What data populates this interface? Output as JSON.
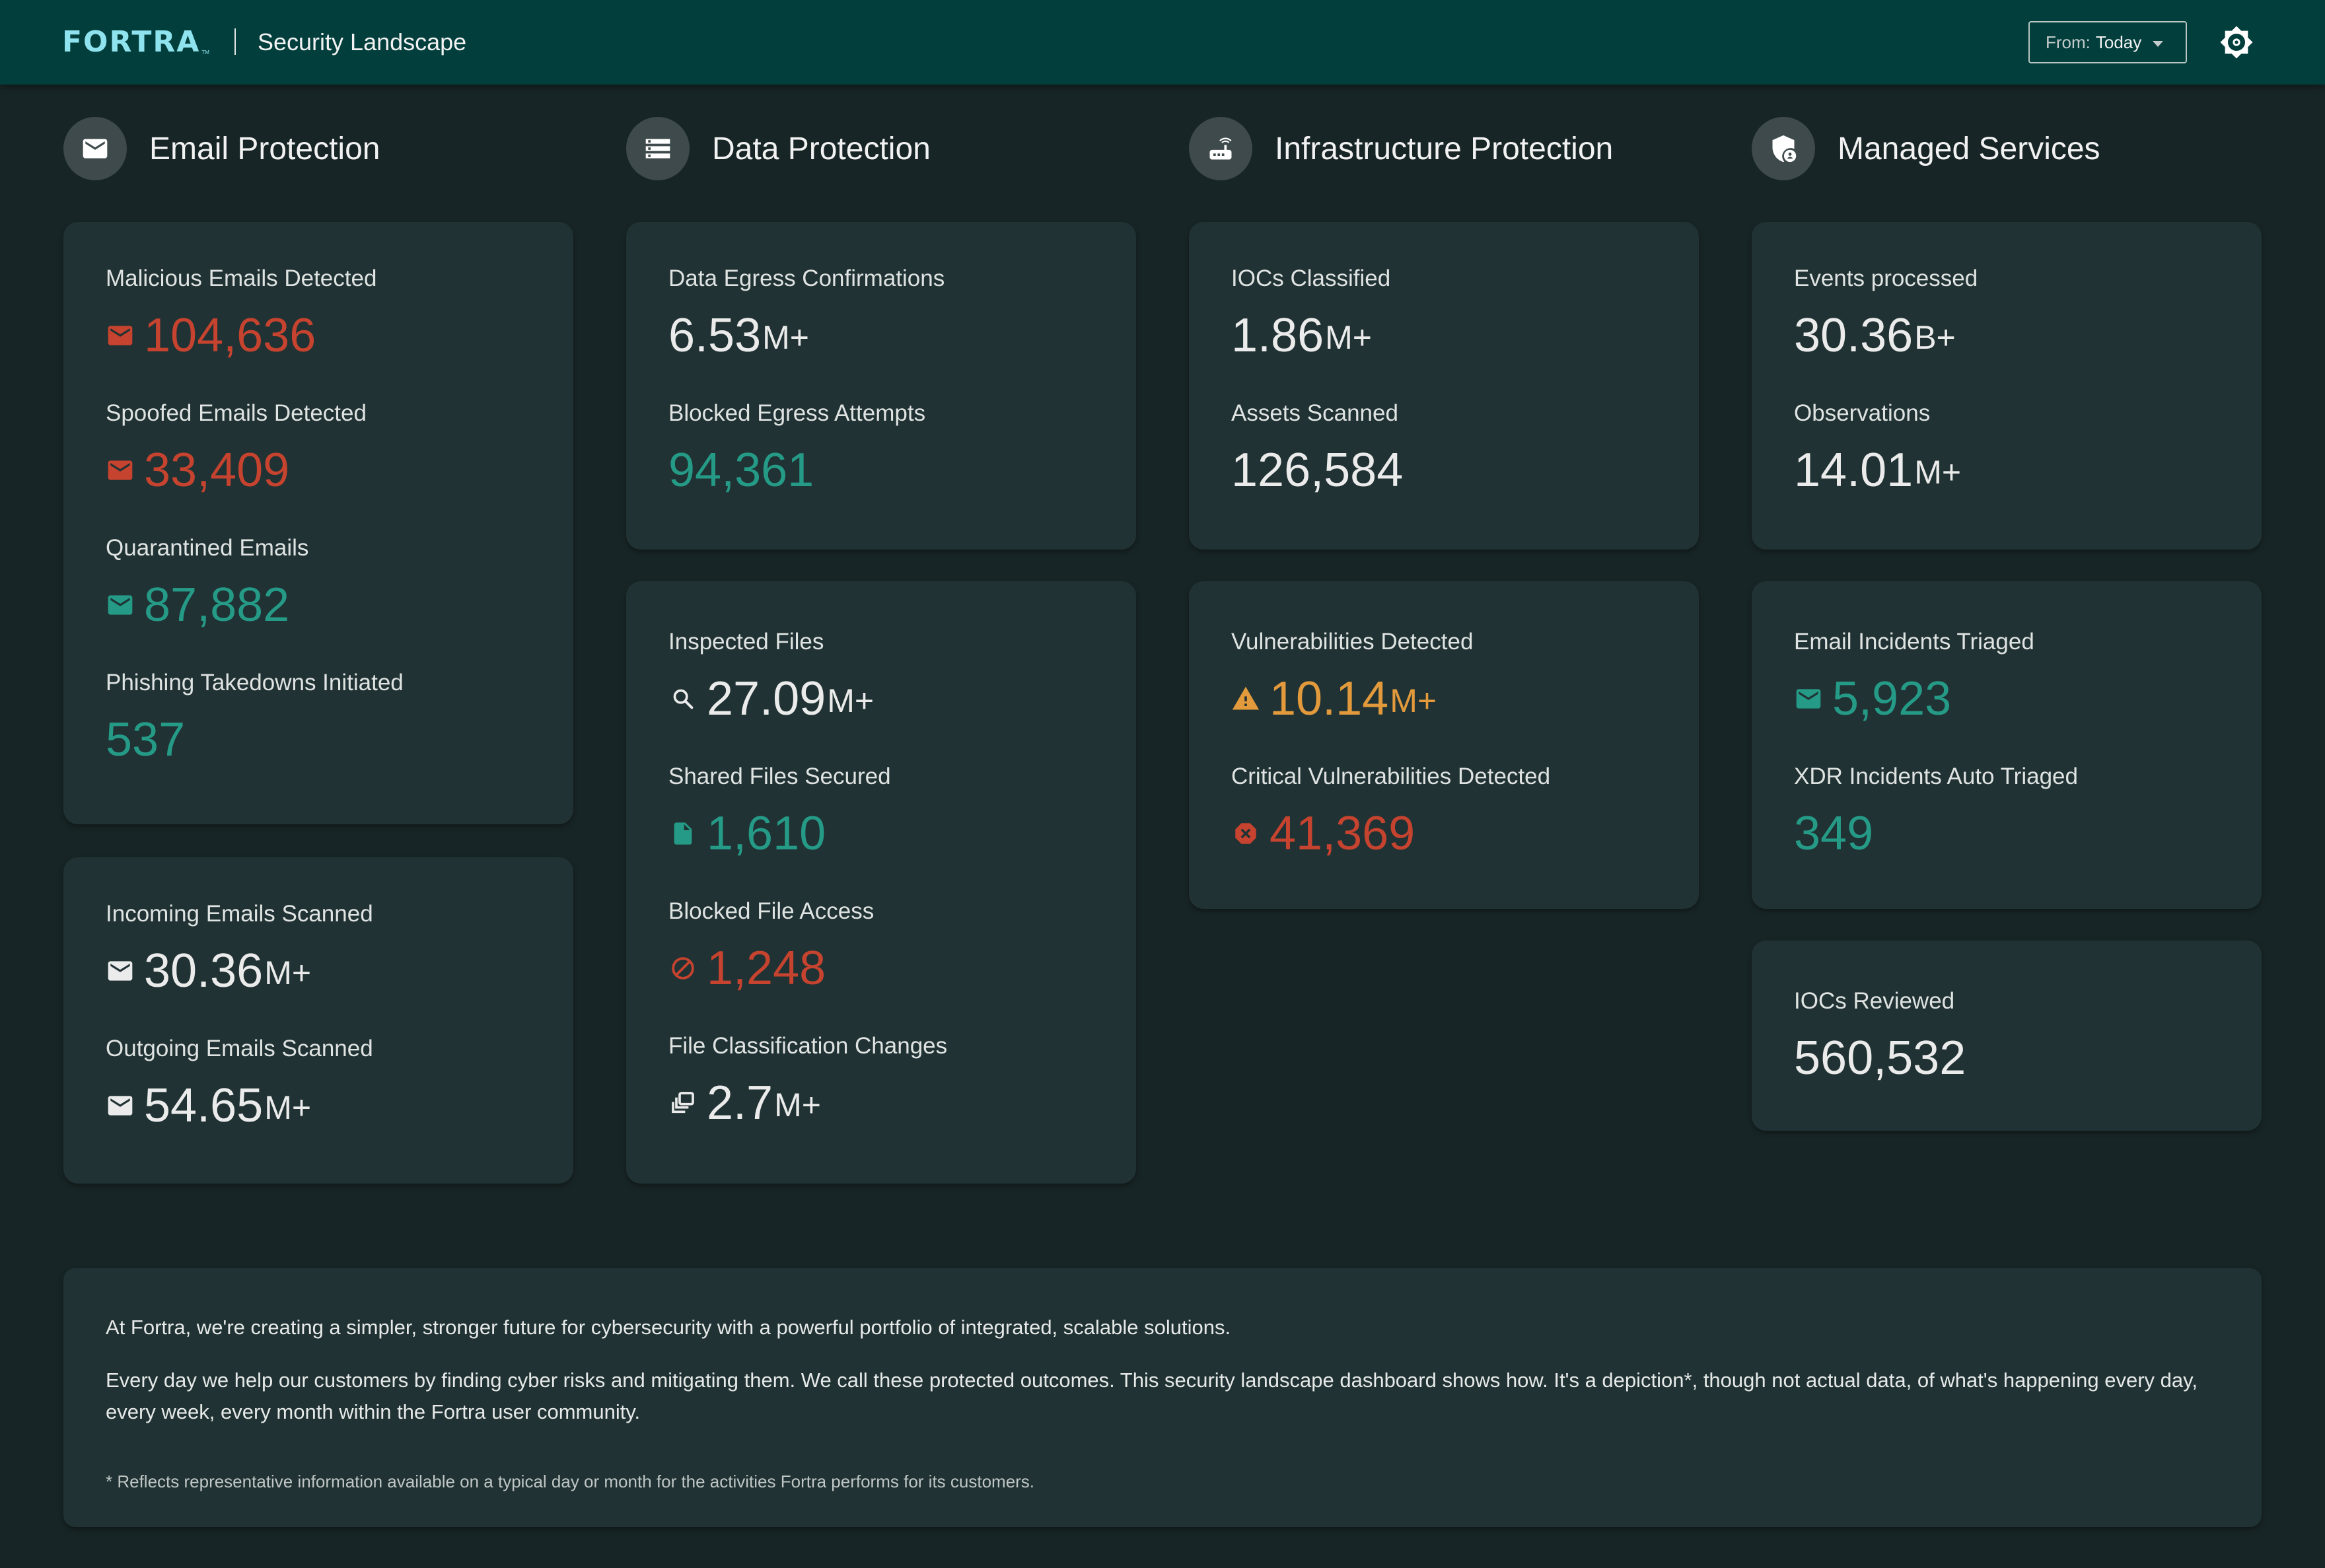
{
  "header": {
    "logo": "FORTRA",
    "logo_tm": "TM",
    "title": "Security Landscape",
    "range_prefix": "From:",
    "range_value": "Today",
    "theme_toggle_icon": "brightness-icon"
  },
  "colors": {
    "header_bg": "#013e3c",
    "page_bg": "#182526",
    "card_bg": "#203233",
    "logo": "#8fe3ee",
    "red": "#c5432f",
    "teal": "#259b87",
    "orange": "#e29a3c",
    "white": "#ebebeb"
  },
  "sections": [
    {
      "title": "Email Protection",
      "icon": "mail-icon",
      "cards": [
        {
          "metrics": [
            {
              "label": "Malicious Emails Detected",
              "value": "104,636",
              "unit": "",
              "icon": "mail-icon",
              "color": "red"
            },
            {
              "label": "Spoofed Emails Detected",
              "value": "33,409",
              "unit": "",
              "icon": "mail-icon",
              "color": "red"
            },
            {
              "label": "Quarantined Emails",
              "value": "87,882",
              "unit": "",
              "icon": "mail-icon",
              "color": "teal"
            },
            {
              "label": "Phishing Takedowns Initiated",
              "value": "537",
              "unit": "",
              "icon": "",
              "color": "teal"
            }
          ]
        },
        {
          "metrics": [
            {
              "label": "Incoming Emails Scanned",
              "value": "30.36",
              "unit": "M+",
              "icon": "mail-icon",
              "color": "white"
            },
            {
              "label": "Outgoing Emails Scanned",
              "value": "54.65",
              "unit": "M+",
              "icon": "mail-icon",
              "color": "white"
            }
          ]
        }
      ]
    },
    {
      "title": "Data Protection",
      "icon": "storage-icon",
      "cards": [
        {
          "metrics": [
            {
              "label": "Data Egress Confirmations",
              "value": "6.53",
              "unit": "M+",
              "icon": "",
              "color": "white"
            },
            {
              "label": "Blocked Egress Attempts",
              "value": "94,361",
              "unit": "",
              "icon": "",
              "color": "teal"
            }
          ]
        },
        {
          "metrics": [
            {
              "label": "Inspected Files",
              "value": "27.09",
              "unit": "M+",
              "icon": "search-icon",
              "color": "white"
            },
            {
              "label": "Shared Files Secured",
              "value": "1,610",
              "unit": "",
              "icon": "file-icon",
              "color": "teal"
            },
            {
              "label": "Blocked File Access",
              "value": "1,248",
              "unit": "",
              "icon": "block-icon",
              "color": "red"
            },
            {
              "label": "File Classification Changes",
              "value": "2.7",
              "unit": "M+",
              "icon": "library-icon",
              "color": "white"
            }
          ]
        }
      ]
    },
    {
      "title": "Infrastructure Protection",
      "icon": "router-icon",
      "cards": [
        {
          "metrics": [
            {
              "label": "IOCs Classified",
              "value": "1.86",
              "unit": "M+",
              "icon": "",
              "color": "white"
            },
            {
              "label": "Assets Scanned",
              "value": "126,584",
              "unit": "",
              "icon": "",
              "color": "white"
            }
          ]
        },
        {
          "metrics": [
            {
              "label": "Vulnerabilities Detected",
              "value": "10.14",
              "unit": "M+",
              "icon": "warning-icon",
              "color": "orange"
            },
            {
              "label": "Critical Vulnerabilities Detected",
              "value": "41,369",
              "unit": "",
              "icon": "error-octagon-icon",
              "color": "red"
            }
          ]
        }
      ]
    },
    {
      "title": "Managed Services",
      "icon": "shield-person-icon",
      "cards": [
        {
          "metrics": [
            {
              "label": "Events processed",
              "value": "30.36",
              "unit": "B+",
              "icon": "",
              "color": "white"
            },
            {
              "label": "Observations",
              "value": "14.01",
              "unit": "M+",
              "icon": "",
              "color": "white"
            }
          ]
        },
        {
          "metrics": [
            {
              "label": "Email Incidents Triaged",
              "value": "5,923",
              "unit": "",
              "icon": "mail-icon",
              "color": "teal"
            },
            {
              "label": "XDR Incidents Auto Triaged",
              "value": "349",
              "unit": "",
              "icon": "",
              "color": "teal"
            }
          ]
        },
        {
          "metrics": [
            {
              "label": "IOCs Reviewed",
              "value": "560,532",
              "unit": "",
              "icon": "",
              "color": "white"
            }
          ]
        }
      ]
    }
  ],
  "footer": {
    "paragraph_1": "At Fortra, we're creating a simpler, stronger future for cybersecurity with a powerful portfolio of integrated, scalable solutions.",
    "paragraph_2": "Every day we help our customers by finding cyber risks and mitigating them. We call these protected outcomes. This security landscape dashboard shows how. It's a depiction*, though not actual data, of what's happening every day, every week, every month within the Fortra user community.",
    "note": "* Reflects representative information available on a typical day or month for the activities Fortra performs for its customers."
  }
}
